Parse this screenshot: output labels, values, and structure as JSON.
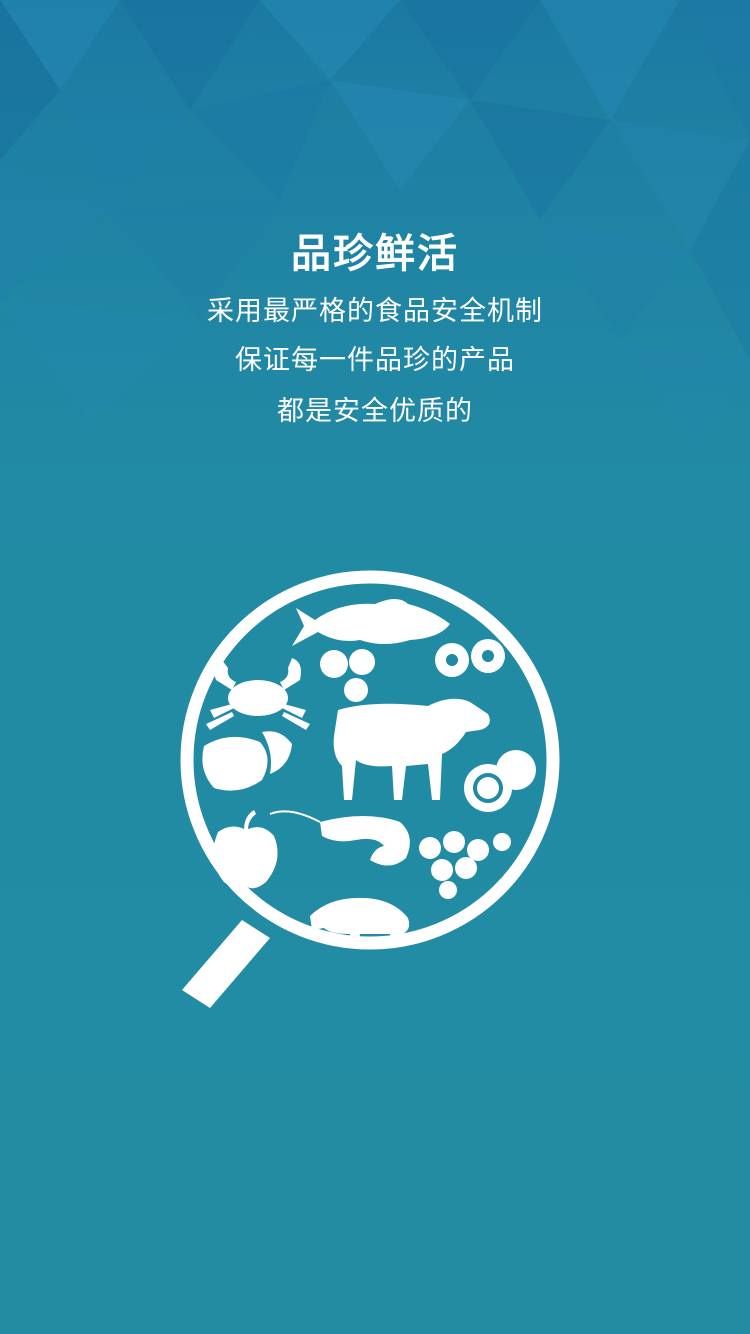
{
  "colors": {
    "background": "#2189a3",
    "background_top": "#1d7ea3",
    "foreground": "#ffffff"
  },
  "intro": {
    "title": "品珍鲜活",
    "lines": [
      "采用最严格的食品安全机制",
      "保证每一件品珍的产品",
      "都是安全优质的"
    ]
  },
  "illustration": {
    "icon": "magnifier-icon",
    "items": [
      "fish-icon",
      "crab-icon",
      "mushroom-icon",
      "blueberry-icon",
      "cow-icon",
      "peach-icon",
      "orange-icon",
      "apple-icon",
      "shrimp-icon",
      "grape-icon",
      "pig-icon"
    ]
  }
}
